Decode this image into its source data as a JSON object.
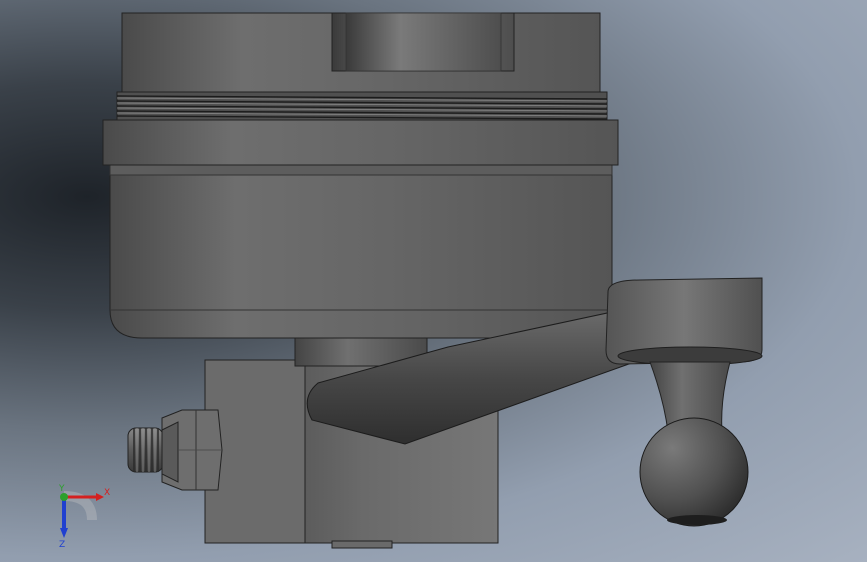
{
  "viewport": {
    "background_dark": "#1e2329",
    "background_light": "#a7b1c0"
  },
  "triad": {
    "x_label": "X",
    "y_label": "Y",
    "z_label": "Z",
    "x_color": "#d42020",
    "y_color": "#2ca02c",
    "z_color": "#2040d0"
  }
}
